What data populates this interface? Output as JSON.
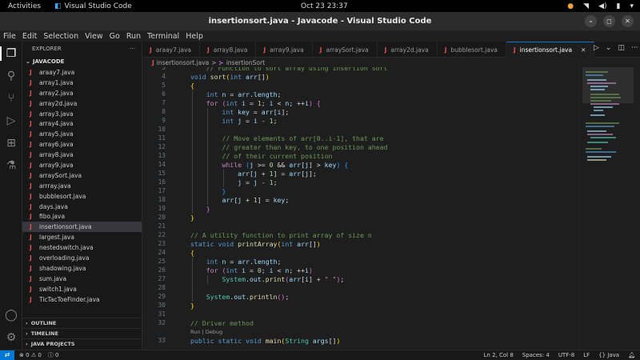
{
  "topbar": {
    "activities": "Activities",
    "app": "Visual Studio Code",
    "clock": "Oct 23  23:37"
  },
  "window": {
    "title": "insertionsort.java - Javacode - Visual Studio Code"
  },
  "menu": [
    "File",
    "Edit",
    "Selection",
    "View",
    "Go",
    "Run",
    "Terminal",
    "Help"
  ],
  "sidebar": {
    "header": "EXPLORER",
    "more": "···",
    "project": "JAVACODE",
    "files": [
      "araay7.java",
      "array1.java",
      "array2.java",
      "array2d.java",
      "array3.java",
      "array4.java",
      "array5.java",
      "array6.java",
      "array8.java",
      "array9.java",
      "arraySort.java",
      "arrray.java",
      "bubblesort.java",
      "days.java",
      "fibo.java",
      "insertionsort.java",
      "largest.java",
      "nestedswitch.java",
      "overloading.java",
      "shadowing.java",
      "sum.java",
      "switch1.java",
      "TicTacToeFinder.java"
    ],
    "selected": "insertionsort.java",
    "sections": [
      "OUTLINE",
      "TIMELINE",
      "JAVA PROJECTS"
    ]
  },
  "tabs": [
    "araay7.java",
    "array8.java",
    "array9.java",
    "arraySort.java",
    "array2d.java",
    "bubblesort.java",
    "insertionsort.java"
  ],
  "active_tab": "insertionsort.java",
  "breadcrumb": {
    "file": "insertionsort.java",
    "sep": ">",
    "symbol": "insertionSort"
  },
  "codelens": "Run | Debug",
  "line_numbers": [
    "3",
    "4",
    "5",
    "6",
    "7",
    "8",
    "9",
    "10",
    "11",
    "12",
    "13",
    "14",
    "15",
    "16",
    "17",
    "18",
    "19",
    "20",
    "21",
    "22",
    "23",
    "24",
    "25",
    "26",
    "27",
    "28",
    "29",
    "30",
    "31",
    "32",
    "33"
  ],
  "statusbar": {
    "errors": "0",
    "warnings": "0",
    "info": "0",
    "position": "Ln 2, Col 8",
    "spaces": "Spaces: 4",
    "encoding": "UTF-8",
    "eol": "LF",
    "language": "Java"
  }
}
